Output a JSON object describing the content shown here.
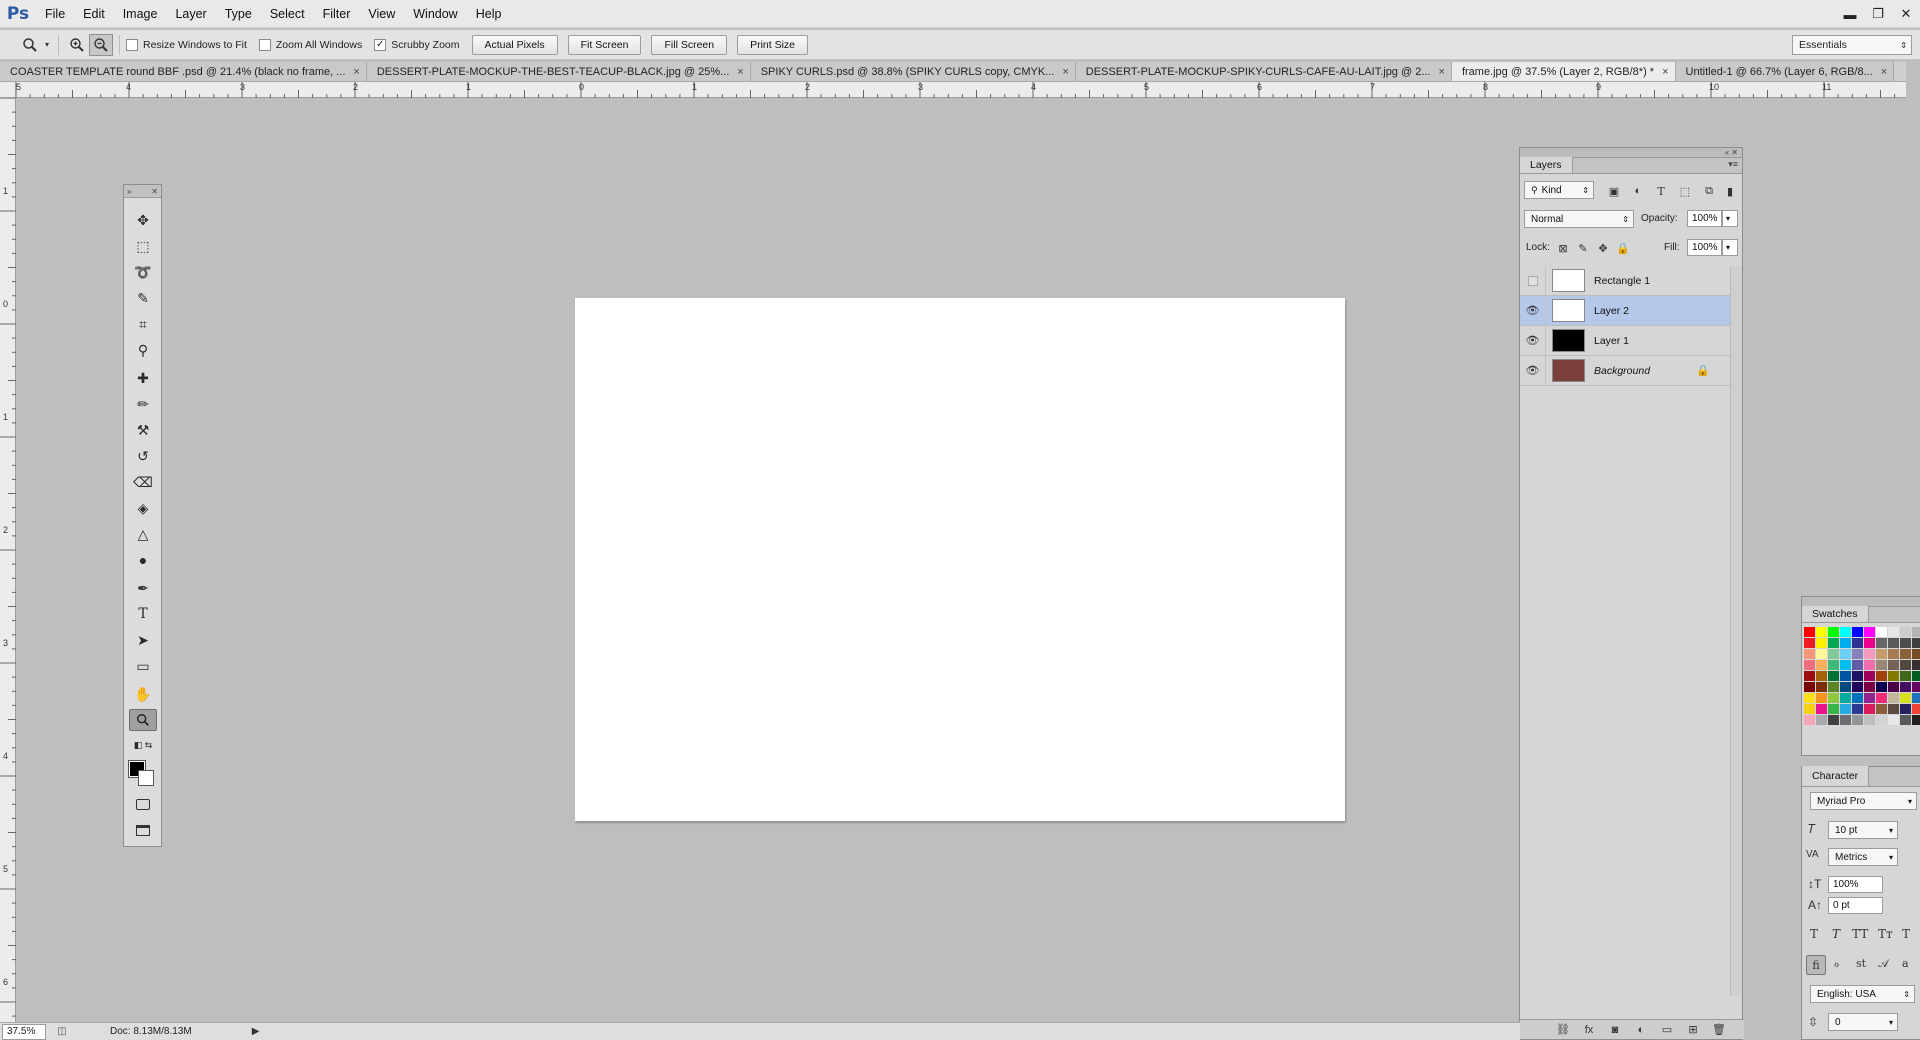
{
  "app": {
    "logo": "Ps"
  },
  "menu": [
    "File",
    "Edit",
    "Image",
    "Layer",
    "Type",
    "Select",
    "Filter",
    "View",
    "Window",
    "Help"
  ],
  "window_controls": {
    "minimize": "▬",
    "restore": "❐",
    "close": "✕"
  },
  "options_bar": {
    "resize_windows_label": "Resize Windows to Fit",
    "resize_windows_checked": false,
    "zoom_all_label": "Zoom All Windows",
    "zoom_all_checked": false,
    "scrubby_label": "Scrubby Zoom",
    "scrubby_checked": true,
    "checkmark": "✓",
    "actual_pixels": "Actual Pixels",
    "fit_screen": "Fit Screen",
    "fill_screen": "Fill Screen",
    "print_size": "Print Size",
    "workspace": "Essentials"
  },
  "tabs": [
    {
      "label": "COASTER TEMPLATE round BBF .psd @ 21.4% (black no frame, ...",
      "active": false
    },
    {
      "label": "DESSERT-PLATE-MOCKUP-THE-BEST-TEACUP-BLACK.jpg @ 25%...",
      "active": false
    },
    {
      "label": "SPIKY CURLS.psd @ 38.8% (SPIKY CURLS copy, CMYK...",
      "active": false
    },
    {
      "label": "DESSERT-PLATE-MOCKUP-SPIKY-CURLS-CAFE-AU-LAIT.jpg @ 2...",
      "active": false
    },
    {
      "label": "frame.jpg @ 37.5% (Layer 2, RGB/8*) *",
      "active": true
    },
    {
      "label": "Untitled-1 @ 66.7% (Layer 6, RGB/8...",
      "active": false
    }
  ],
  "tab_close": "×",
  "ruler_h": [
    "5",
    "4",
    "3",
    "2",
    "1",
    "0",
    "1",
    "2",
    "3",
    "4",
    "5",
    "6",
    "7",
    "8",
    "9",
    "10",
    "11"
  ],
  "ruler_v": [
    "1",
    "0",
    "1",
    "2",
    "3",
    "4",
    "5",
    "6"
  ],
  "tools": [
    {
      "name": "move-tool-icon",
      "glyph": "✥"
    },
    {
      "name": "marquee-tool-icon",
      "glyph": "⬚"
    },
    {
      "name": "lasso-tool-icon",
      "glyph": "➰"
    },
    {
      "name": "quick-select-tool-icon",
      "glyph": "✎"
    },
    {
      "name": "crop-tool-icon",
      "glyph": "⌗"
    },
    {
      "name": "eyedropper-tool-icon",
      "glyph": "⚲"
    },
    {
      "name": "healing-brush-tool-icon",
      "glyph": "✚"
    },
    {
      "name": "brush-tool-icon",
      "glyph": "✏"
    },
    {
      "name": "clone-stamp-tool-icon",
      "glyph": "⚒"
    },
    {
      "name": "history-brush-tool-icon",
      "glyph": "↺"
    },
    {
      "name": "eraser-tool-icon",
      "glyph": "⌫"
    },
    {
      "name": "paint-bucket-tool-icon",
      "glyph": "◈"
    },
    {
      "name": "blur-tool-icon",
      "glyph": "△"
    },
    {
      "name": "dodge-tool-icon",
      "glyph": "●"
    },
    {
      "name": "pen-tool-icon",
      "glyph": "✒"
    },
    {
      "name": "type-tool-icon",
      "glyph": "T"
    },
    {
      "name": "path-select-tool-icon",
      "glyph": "➤"
    },
    {
      "name": "rectangle-tool-icon",
      "glyph": "▭"
    },
    {
      "name": "hand-tool-icon",
      "glyph": "✋"
    },
    {
      "name": "zoom-tool-icon",
      "glyph": "🔍"
    }
  ],
  "layers_panel": {
    "tab": "Layers",
    "filter_kind": "Kind",
    "blend_mode": "Normal",
    "opacity_label": "Opacity:",
    "opacity": "100%",
    "lock_label": "Lock:",
    "fill_label": "Fill:",
    "fill": "100%",
    "layers": [
      {
        "name": "Rectangle 1",
        "visible": false,
        "thumb": "#ffffff",
        "italic": false,
        "selected": false,
        "locked": false
      },
      {
        "name": "Layer 2",
        "visible": true,
        "thumb": "#ffffff",
        "italic": false,
        "selected": true,
        "locked": false
      },
      {
        "name": "Layer 1",
        "visible": true,
        "thumb": "#000000",
        "italic": false,
        "selected": false,
        "locked": false
      },
      {
        "name": "Background",
        "visible": true,
        "thumb": "#7a3f3a",
        "italic": true,
        "selected": false,
        "locked": true
      }
    ]
  },
  "swatches_panel": {
    "tab": "Swatches",
    "colors": [
      "#ff0000",
      "#ffff00",
      "#00ff00",
      "#00ffff",
      "#0000ff",
      "#ff00ff",
      "#ffffff",
      "#e6e6e6",
      "#cccccc",
      "#b3b3b3",
      "#999999",
      "#808080",
      "#ed1c24",
      "#fff200",
      "#00a651",
      "#00aeef",
      "#2e3192",
      "#ec008c",
      "#666666",
      "#595959",
      "#4d4d4d",
      "#404040",
      "#333333",
      "#1a1a1a",
      "#f7977a",
      "#fff799",
      "#82ca9c",
      "#6dcff6",
      "#8781bd",
      "#f49ac1",
      "#c69c6d",
      "#a67c52",
      "#8c6239",
      "#754c24",
      "#603913",
      "#f5989d",
      "#f26d7d",
      "#fbaf5d",
      "#3cb878",
      "#00bff3",
      "#605ca8",
      "#f06eaa",
      "#998675",
      "#736357",
      "#534741",
      "#362f2d",
      "#c7b299",
      "#f9ad81",
      "#9e0b0f",
      "#a36209",
      "#007236",
      "#0054a6",
      "#1b1464",
      "#9e005d",
      "#a0410d",
      "#827b00",
      "#406618",
      "#005e20",
      "#005b7f",
      "#003663",
      "#790000",
      "#7b2e00",
      "#598527",
      "#004a80",
      "#21005d",
      "#7b0046",
      "#0d004c",
      "#4b0049",
      "#440e62",
      "#630460",
      "#9e0039",
      "#f2f2f2",
      "#ffde17",
      "#f7941d",
      "#8dc63f",
      "#00a99d",
      "#0072bc",
      "#92278f",
      "#ee2a7b",
      "#c2b59b",
      "#d7df23",
      "#1c75bc",
      "#be1e2d",
      "#f15a29",
      "#f7d117",
      "#e9118c",
      "#39b54a",
      "#27aae1",
      "#2b3990",
      "#da1c5c",
      "#8b5e3c",
      "#5a4a42",
      "#262262",
      "#ef4136",
      "#fbb040",
      "#ffffff",
      "#f4a7b9",
      "#a7a9ac",
      "#414042",
      "#6d6e71",
      "#939598",
      "#bcbec0",
      "#d1d3d4",
      "#e6e7e8",
      "#58595b",
      "#231f20",
      "#ffc20e",
      "#00a14b"
    ]
  },
  "character_panel": {
    "tab": "Character",
    "font": "Myriad Pro",
    "size": "10 pt",
    "kerning": "Metrics",
    "scale": "100%",
    "baseline": "0 pt",
    "styles": [
      "T",
      "T",
      "TT",
      "Tт",
      "T"
    ],
    "opentype": [
      "fi",
      "ℴ",
      "st",
      "𝒜",
      "a"
    ],
    "language": "English: USA",
    "leading": "0"
  },
  "status_bar": {
    "zoom": "37.5%",
    "doc": "Doc: 8.13M/8.13M"
  }
}
